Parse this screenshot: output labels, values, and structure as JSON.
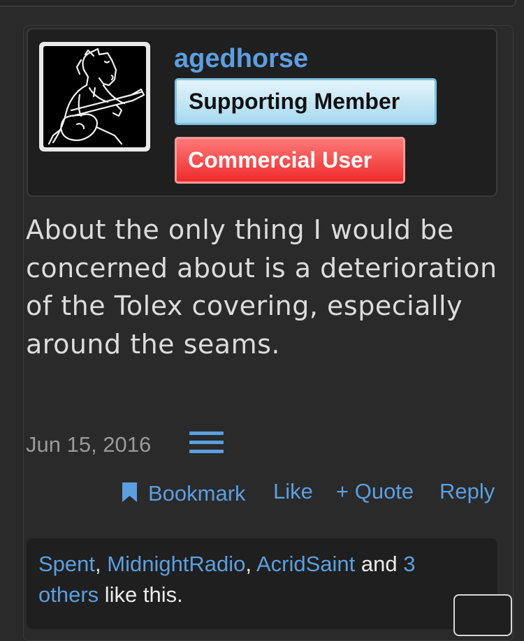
{
  "user": {
    "username": "agedhorse",
    "badges": {
      "supporting": "Supporting Member",
      "commercial": "Commercial User"
    }
  },
  "post": {
    "message": "About the only thing I would be concerned about is a deterioration of the Tolex covering, especially around the seams.",
    "date": "Jun 15, 2016"
  },
  "actions": {
    "bookmark": "Bookmark",
    "like": "Like",
    "quote": "+ Quote",
    "reply": "Reply"
  },
  "likes": {
    "users": [
      "Spent",
      "MidnightRadio",
      "AcridSaint"
    ],
    "separator": ", ",
    "and": " and ",
    "others_count": "3",
    "others_word": "others",
    "suffix": " like this."
  },
  "colors": {
    "link": "#5b9fe0",
    "supporting_badge": "#a8d9ef",
    "commercial_badge": "#ee2b2b",
    "background": "#2a2a2a"
  },
  "icons": {
    "post_menu": "hamburger-menu-icon",
    "bookmark": "bookmark-icon"
  }
}
